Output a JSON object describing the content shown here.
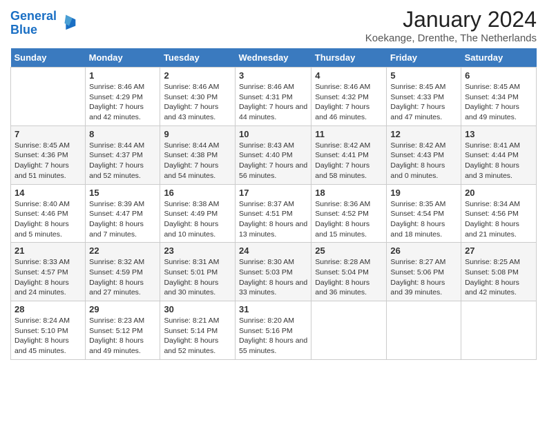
{
  "logo": {
    "line1": "General",
    "line2": "Blue"
  },
  "title": "January 2024",
  "subtitle": "Koekange, Drenthe, The Netherlands",
  "days_of_week": [
    "Sunday",
    "Monday",
    "Tuesday",
    "Wednesday",
    "Thursday",
    "Friday",
    "Saturday"
  ],
  "weeks": [
    [
      {
        "num": "",
        "sunrise": "",
        "sunset": "",
        "daylight": ""
      },
      {
        "num": "1",
        "sunrise": "Sunrise: 8:46 AM",
        "sunset": "Sunset: 4:29 PM",
        "daylight": "Daylight: 7 hours and 42 minutes."
      },
      {
        "num": "2",
        "sunrise": "Sunrise: 8:46 AM",
        "sunset": "Sunset: 4:30 PM",
        "daylight": "Daylight: 7 hours and 43 minutes."
      },
      {
        "num": "3",
        "sunrise": "Sunrise: 8:46 AM",
        "sunset": "Sunset: 4:31 PM",
        "daylight": "Daylight: 7 hours and 44 minutes."
      },
      {
        "num": "4",
        "sunrise": "Sunrise: 8:46 AM",
        "sunset": "Sunset: 4:32 PM",
        "daylight": "Daylight: 7 hours and 46 minutes."
      },
      {
        "num": "5",
        "sunrise": "Sunrise: 8:45 AM",
        "sunset": "Sunset: 4:33 PM",
        "daylight": "Daylight: 7 hours and 47 minutes."
      },
      {
        "num": "6",
        "sunrise": "Sunrise: 8:45 AM",
        "sunset": "Sunset: 4:34 PM",
        "daylight": "Daylight: 7 hours and 49 minutes."
      }
    ],
    [
      {
        "num": "7",
        "sunrise": "Sunrise: 8:45 AM",
        "sunset": "Sunset: 4:36 PM",
        "daylight": "Daylight: 7 hours and 51 minutes."
      },
      {
        "num": "8",
        "sunrise": "Sunrise: 8:44 AM",
        "sunset": "Sunset: 4:37 PM",
        "daylight": "Daylight: 7 hours and 52 minutes."
      },
      {
        "num": "9",
        "sunrise": "Sunrise: 8:44 AM",
        "sunset": "Sunset: 4:38 PM",
        "daylight": "Daylight: 7 hours and 54 minutes."
      },
      {
        "num": "10",
        "sunrise": "Sunrise: 8:43 AM",
        "sunset": "Sunset: 4:40 PM",
        "daylight": "Daylight: 7 hours and 56 minutes."
      },
      {
        "num": "11",
        "sunrise": "Sunrise: 8:42 AM",
        "sunset": "Sunset: 4:41 PM",
        "daylight": "Daylight: 7 hours and 58 minutes."
      },
      {
        "num": "12",
        "sunrise": "Sunrise: 8:42 AM",
        "sunset": "Sunset: 4:43 PM",
        "daylight": "Daylight: 8 hours and 0 minutes."
      },
      {
        "num": "13",
        "sunrise": "Sunrise: 8:41 AM",
        "sunset": "Sunset: 4:44 PM",
        "daylight": "Daylight: 8 hours and 3 minutes."
      }
    ],
    [
      {
        "num": "14",
        "sunrise": "Sunrise: 8:40 AM",
        "sunset": "Sunset: 4:46 PM",
        "daylight": "Daylight: 8 hours and 5 minutes."
      },
      {
        "num": "15",
        "sunrise": "Sunrise: 8:39 AM",
        "sunset": "Sunset: 4:47 PM",
        "daylight": "Daylight: 8 hours and 7 minutes."
      },
      {
        "num": "16",
        "sunrise": "Sunrise: 8:38 AM",
        "sunset": "Sunset: 4:49 PM",
        "daylight": "Daylight: 8 hours and 10 minutes."
      },
      {
        "num": "17",
        "sunrise": "Sunrise: 8:37 AM",
        "sunset": "Sunset: 4:51 PM",
        "daylight": "Daylight: 8 hours and 13 minutes."
      },
      {
        "num": "18",
        "sunrise": "Sunrise: 8:36 AM",
        "sunset": "Sunset: 4:52 PM",
        "daylight": "Daylight: 8 hours and 15 minutes."
      },
      {
        "num": "19",
        "sunrise": "Sunrise: 8:35 AM",
        "sunset": "Sunset: 4:54 PM",
        "daylight": "Daylight: 8 hours and 18 minutes."
      },
      {
        "num": "20",
        "sunrise": "Sunrise: 8:34 AM",
        "sunset": "Sunset: 4:56 PM",
        "daylight": "Daylight: 8 hours and 21 minutes."
      }
    ],
    [
      {
        "num": "21",
        "sunrise": "Sunrise: 8:33 AM",
        "sunset": "Sunset: 4:57 PM",
        "daylight": "Daylight: 8 hours and 24 minutes."
      },
      {
        "num": "22",
        "sunrise": "Sunrise: 8:32 AM",
        "sunset": "Sunset: 4:59 PM",
        "daylight": "Daylight: 8 hours and 27 minutes."
      },
      {
        "num": "23",
        "sunrise": "Sunrise: 8:31 AM",
        "sunset": "Sunset: 5:01 PM",
        "daylight": "Daylight: 8 hours and 30 minutes."
      },
      {
        "num": "24",
        "sunrise": "Sunrise: 8:30 AM",
        "sunset": "Sunset: 5:03 PM",
        "daylight": "Daylight: 8 hours and 33 minutes."
      },
      {
        "num": "25",
        "sunrise": "Sunrise: 8:28 AM",
        "sunset": "Sunset: 5:04 PM",
        "daylight": "Daylight: 8 hours and 36 minutes."
      },
      {
        "num": "26",
        "sunrise": "Sunrise: 8:27 AM",
        "sunset": "Sunset: 5:06 PM",
        "daylight": "Daylight: 8 hours and 39 minutes."
      },
      {
        "num": "27",
        "sunrise": "Sunrise: 8:25 AM",
        "sunset": "Sunset: 5:08 PM",
        "daylight": "Daylight: 8 hours and 42 minutes."
      }
    ],
    [
      {
        "num": "28",
        "sunrise": "Sunrise: 8:24 AM",
        "sunset": "Sunset: 5:10 PM",
        "daylight": "Daylight: 8 hours and 45 minutes."
      },
      {
        "num": "29",
        "sunrise": "Sunrise: 8:23 AM",
        "sunset": "Sunset: 5:12 PM",
        "daylight": "Daylight: 8 hours and 49 minutes."
      },
      {
        "num": "30",
        "sunrise": "Sunrise: 8:21 AM",
        "sunset": "Sunset: 5:14 PM",
        "daylight": "Daylight: 8 hours and 52 minutes."
      },
      {
        "num": "31",
        "sunrise": "Sunrise: 8:20 AM",
        "sunset": "Sunset: 5:16 PM",
        "daylight": "Daylight: 8 hours and 55 minutes."
      },
      {
        "num": "",
        "sunrise": "",
        "sunset": "",
        "daylight": ""
      },
      {
        "num": "",
        "sunrise": "",
        "sunset": "",
        "daylight": ""
      },
      {
        "num": "",
        "sunrise": "",
        "sunset": "",
        "daylight": ""
      }
    ]
  ]
}
